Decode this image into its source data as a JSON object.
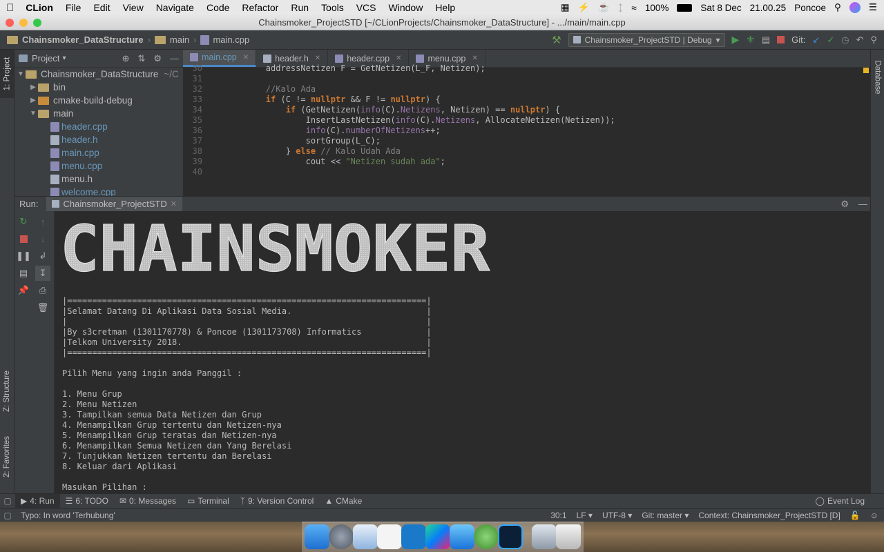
{
  "menubar": {
    "app": "CLion",
    "items": [
      "File",
      "Edit",
      "View",
      "Navigate",
      "Code",
      "Refactor",
      "Run",
      "Tools",
      "VCS",
      "Window",
      "Help"
    ],
    "battery": "100%",
    "date": "Sat 8 Dec",
    "time": "21.00.25",
    "user": "Poncoe"
  },
  "window": {
    "title": "Chainsmoker_ProjectSTD [~/CLionProjects/Chainsmoker_DataStructure] - .../main/main.cpp"
  },
  "navbar": {
    "crumbs": [
      "Chainsmoker_DataStructure",
      "main",
      "main.cpp"
    ],
    "run_config": "Chainsmoker_ProjectSTD | Debug",
    "git_label": "Git:"
  },
  "left_tools": {
    "project": "1: Project",
    "structure": "Z: Structure",
    "favorites": "2: Favorites"
  },
  "right_tools": {
    "database": "Database"
  },
  "project": {
    "header": "Project",
    "root": "Chainsmoker_DataStructure",
    "root_path": "~/C",
    "items": [
      {
        "label": "bin",
        "kind": "folder",
        "depth": 1
      },
      {
        "label": "cmake-build-debug",
        "kind": "folder-orange",
        "depth": 1
      },
      {
        "label": "main",
        "kind": "folder",
        "depth": 1,
        "open": true
      },
      {
        "label": "header.cpp",
        "kind": "cpp",
        "depth": 2
      },
      {
        "label": "header.h",
        "kind": "h",
        "depth": 2
      },
      {
        "label": "main.cpp",
        "kind": "cpp",
        "depth": 2
      },
      {
        "label": "menu.cpp",
        "kind": "cpp",
        "depth": 2
      },
      {
        "label": "menu.h",
        "kind": "h",
        "depth": 2
      },
      {
        "label": "welcome.cpp",
        "kind": "cpp",
        "depth": 2
      }
    ]
  },
  "editor": {
    "tabs": [
      "main.cpp",
      "header.h",
      "header.cpp",
      "menu.cpp"
    ],
    "active_tab": "main.cpp",
    "lines": [
      {
        "n": "30",
        "parts": [
          [
            "",
            "        addressNetizen F = GetNetizen(L_F, Netizen);"
          ]
        ]
      },
      {
        "n": "31",
        "parts": [
          [
            "",
            ""
          ]
        ]
      },
      {
        "n": "32",
        "parts": [
          [
            "cm",
            "        //Kalo Ada"
          ]
        ]
      },
      {
        "n": "33",
        "parts": [
          [
            "kw",
            "        if"
          ],
          [
            "",
            " (C != "
          ],
          [
            "kw",
            "nullptr"
          ],
          [
            "",
            " && F != "
          ],
          [
            "kw",
            "nullptr"
          ],
          [
            "",
            ") {"
          ]
        ]
      },
      {
        "n": "34",
        "parts": [
          [
            "kw",
            "            if"
          ],
          [
            "",
            " (GetNetizen("
          ],
          [
            "pu",
            "info"
          ],
          [
            "",
            "(C)."
          ],
          [
            "pu",
            "Netizens"
          ],
          [
            "",
            ", Netizen) == "
          ],
          [
            "kw",
            "nullptr"
          ],
          [
            "",
            ") {"
          ]
        ]
      },
      {
        "n": "35",
        "parts": [
          [
            "",
            "                InsertLastNetizen("
          ],
          [
            "pu",
            "info"
          ],
          [
            "",
            "(C)."
          ],
          [
            "pu",
            "Netizens"
          ],
          [
            "",
            ", AllocateNetizen(Netizen));"
          ]
        ]
      },
      {
        "n": "36",
        "parts": [
          [
            "pu",
            "                info"
          ],
          [
            "",
            "(C)."
          ],
          [
            "pu",
            "numberOfNetizens"
          ],
          [
            "",
            "++;"
          ]
        ]
      },
      {
        "n": "37",
        "parts": [
          [
            "",
            "                sortGroup(L_C);"
          ]
        ]
      },
      {
        "n": "38",
        "parts": [
          [
            "",
            "            } "
          ],
          [
            "kw",
            "else"
          ],
          [
            "cm",
            " // Kalo Udah Ada"
          ]
        ]
      },
      {
        "n": "39",
        "parts": [
          [
            "",
            "                cout << "
          ],
          [
            "st",
            "\"Netizen sudah ada\""
          ],
          [
            "",
            ";"
          ]
        ]
      },
      {
        "n": "40",
        "parts": [
          [
            "",
            ""
          ]
        ]
      }
    ]
  },
  "run": {
    "label": "Run:",
    "tab": "Chainsmoker_ProjectSTD",
    "console": [
      "|========================================================================|",
      "|Selamat Datang Di Aplikasi Data Sosial Media.                           |",
      "|                                                                        |",
      "|By s3cretman (1301170778) & Poncoe (1301173708) Informatics             |",
      "|Telkom University 2018.                                                 |",
      "|========================================================================|",
      "",
      "Pilih Menu yang ingin anda Panggil :",
      "",
      "1. Menu Grup",
      "2. Menu Netizen",
      "3. Tampilkan semua Data Netizen dan Grup",
      "4. Menampilkan Grup tertentu dan Netizen-nya",
      "5. Menampilkan Grup teratas dan Netizen-nya",
      "6. Menampilkan Semua Netizen dan Yang Berelasi",
      "7. Tunjukkan Netizen tertentu dan Berelasi",
      "8. Keluar dari Aplikasi",
      "",
      "Masukan Pilihan :"
    ],
    "banner": "CHAINSMOKER"
  },
  "bottombar": {
    "items": [
      "4: Run",
      "6: TODO",
      "0: Messages",
      "Terminal",
      "9: Version Control",
      "CMake"
    ],
    "event_log": "Event Log"
  },
  "statusbar": {
    "message": "Typo: In word 'Terhubung'",
    "position": "30:1",
    "line_sep": "LF",
    "encoding": "UTF-8",
    "git": "Git: master",
    "context": "Context: Chainsmoker_ProjectSTD [D]"
  },
  "colors": {
    "accent": "#4a88c7",
    "run_green": "#499c54",
    "stop_red": "#c75450"
  }
}
